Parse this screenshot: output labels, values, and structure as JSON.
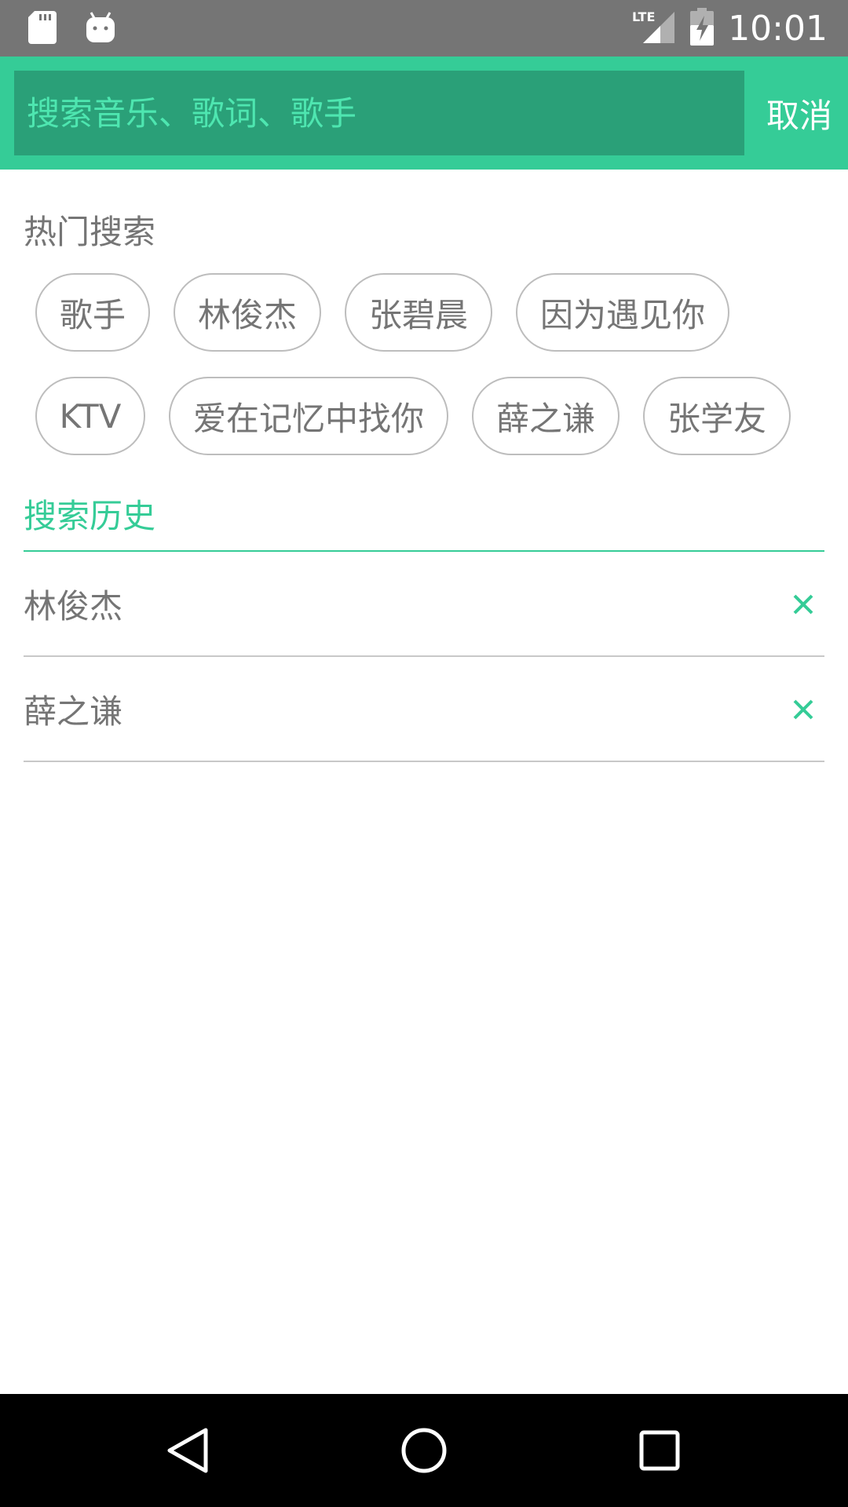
{
  "status_bar": {
    "time": "10:01",
    "network": "LTE",
    "icons": [
      "sd-card-icon",
      "android-icon",
      "lte-signal-icon",
      "battery-charging-icon"
    ]
  },
  "search": {
    "placeholder": "搜索音乐、歌词、歌手",
    "cancel_label": "取消"
  },
  "hot": {
    "title": "热门搜索",
    "chips": [
      "歌手",
      "林俊杰",
      "张碧晨",
      "因为遇见你",
      "KTV",
      "爱在记忆中找你",
      "薛之谦",
      "张学友"
    ]
  },
  "history": {
    "title": "搜索历史",
    "items": [
      "林俊杰",
      "薛之谦"
    ]
  },
  "colors": {
    "accent": "#35cc97",
    "search_box": "#2aa078",
    "status_bar": "#757575",
    "text_gray": "#757575"
  },
  "nav_bar": {
    "icons": [
      "back-icon",
      "home-icon",
      "recents-icon"
    ]
  }
}
